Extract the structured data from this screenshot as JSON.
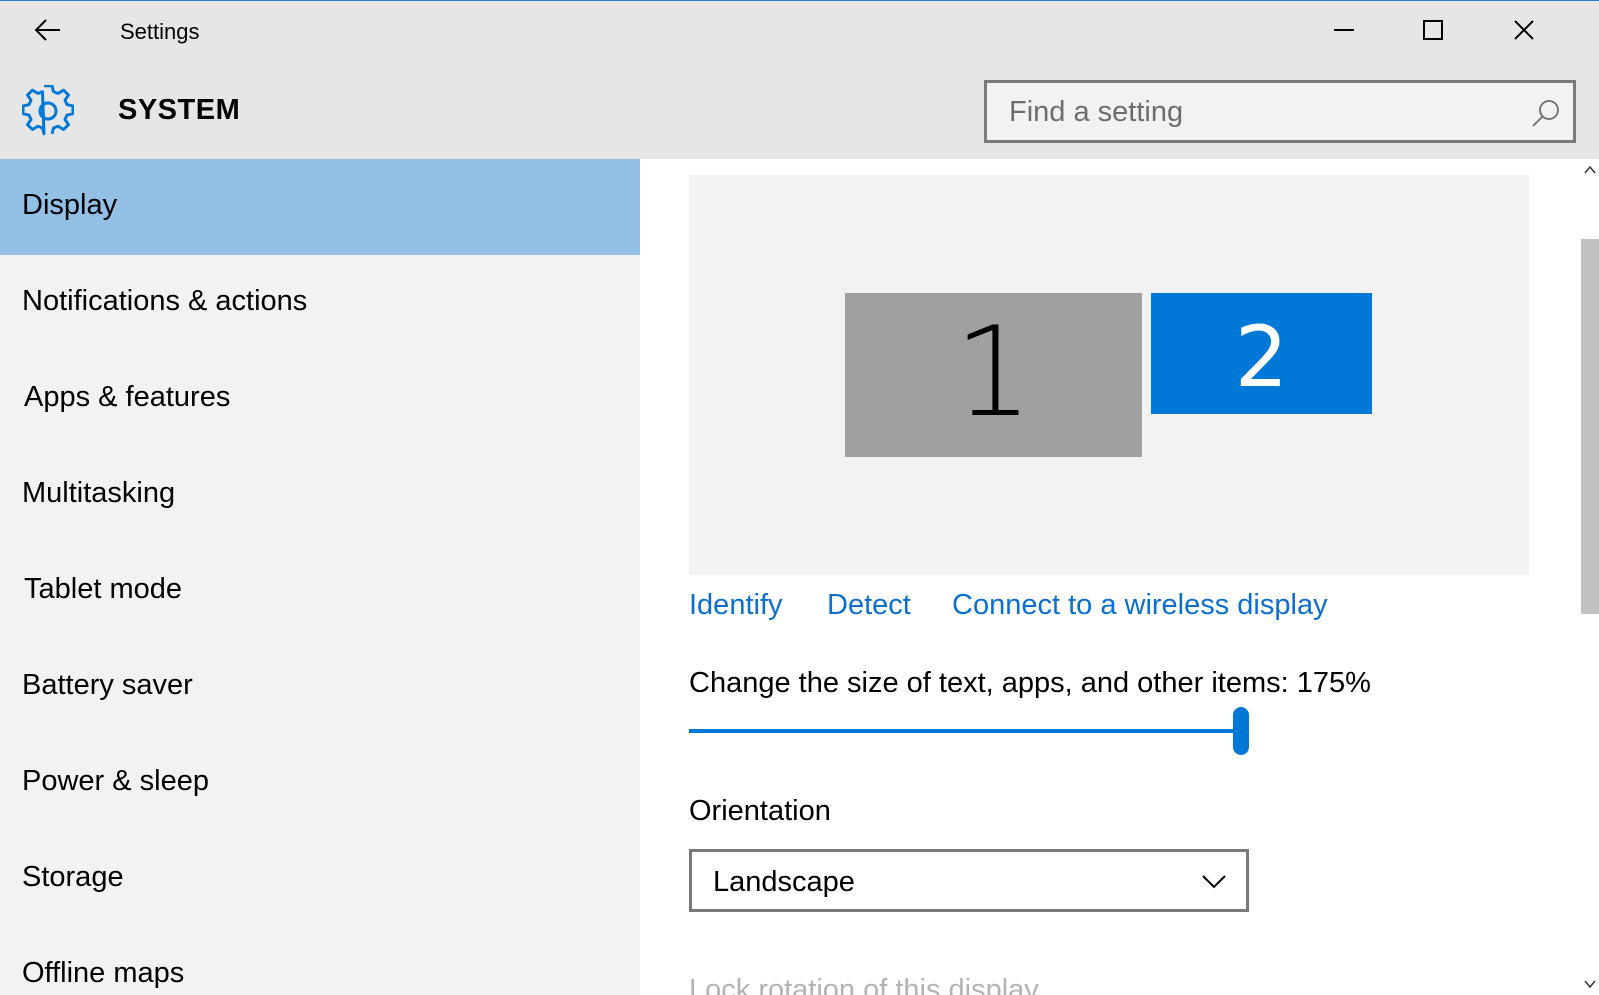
{
  "window": {
    "title": "Settings",
    "icons": {
      "back": "arrow-left-icon",
      "minimize": "minimize-icon",
      "maximize": "maximize-icon",
      "close": "close-icon"
    }
  },
  "header": {
    "section_title": "SYSTEM",
    "section_icon": "gear-icon",
    "search_placeholder": "Find a setting",
    "search_icon": "search-icon"
  },
  "sidebar": {
    "selected": "Display",
    "items": [
      {
        "label": "Display"
      },
      {
        "label": "Notifications & actions"
      },
      {
        "label": "Apps & features"
      },
      {
        "label": "Multitasking"
      },
      {
        "label": "Tablet mode"
      },
      {
        "label": "Battery saver"
      },
      {
        "label": "Power & sleep"
      },
      {
        "label": "Storage"
      },
      {
        "label": "Offline maps"
      }
    ]
  },
  "display": {
    "monitors": [
      {
        "label": "1",
        "selected": false
      },
      {
        "label": "2",
        "selected": true
      }
    ],
    "links": {
      "identify": "Identify",
      "detect": "Detect",
      "wireless": "Connect to a wireless display"
    },
    "scale_label": "Change the size of text, apps, and other items: 175%",
    "scale_slider_fraction": 1.0,
    "orientation_label": "Orientation",
    "orientation_value": "Landscape",
    "lock_rotation_label": "Lock rotation of this display"
  },
  "colors": {
    "accent": "#0078d7",
    "selected_nav": "#92c0e7",
    "link": "#0a6fcf",
    "monitor_inactive": "#a0a0a0"
  }
}
